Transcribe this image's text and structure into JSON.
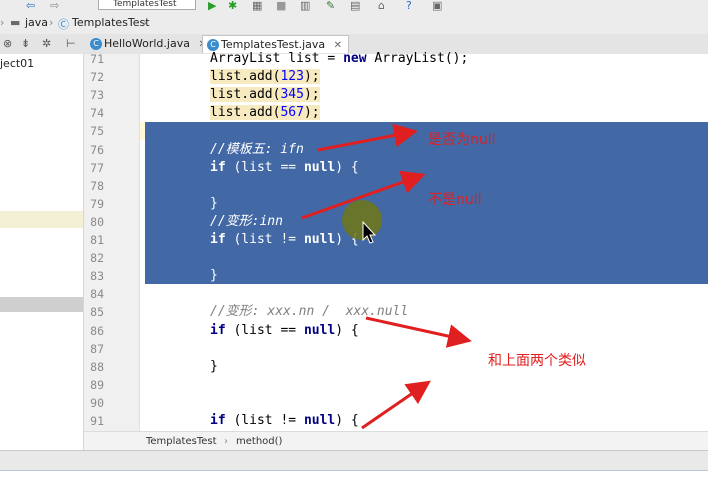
{
  "toolbar": {
    "run_config": "TemplatesTest",
    "icons": [
      "back-icon",
      "forward-icon",
      "run-icon",
      "debug-icon",
      "coverage-icon",
      "stop-icon",
      "project-structure-icon",
      "settings-icon",
      "sdk-icon",
      "help-icon",
      "tool-icon"
    ]
  },
  "breadcrumb": {
    "folder": "java",
    "class": "TemplatesTest"
  },
  "tabs": [
    {
      "label": "HelloWorld.java",
      "active": false
    },
    {
      "label": "TemplatesTest.java",
      "active": true
    }
  ],
  "project_panel": {
    "item": "ject01"
  },
  "editor": {
    "lines": [
      {
        "n": "71",
        "text": "ArrayList list = new ArrayList();"
      },
      {
        "n": "72",
        "text": "list.add(123);"
      },
      {
        "n": "73",
        "text": "list.add(345);"
      },
      {
        "n": "74",
        "text": "list.add(567);"
      },
      {
        "n": "75",
        "text": ""
      },
      {
        "n": "76",
        "text": "//模板五: ifn"
      },
      {
        "n": "77",
        "text": "if (list == null) {"
      },
      {
        "n": "78",
        "text": ""
      },
      {
        "n": "79",
        "text": "}"
      },
      {
        "n": "80",
        "text": "//变形:inn"
      },
      {
        "n": "81",
        "text": "if (list != null) {"
      },
      {
        "n": "82",
        "text": ""
      },
      {
        "n": "83",
        "text": "}"
      },
      {
        "n": "84",
        "text": ""
      },
      {
        "n": "85",
        "text": "//变形: xxx.nn /  xxx.null"
      },
      {
        "n": "86",
        "text": "if (list == null) {"
      },
      {
        "n": "87",
        "text": ""
      },
      {
        "n": "88",
        "text": "}"
      },
      {
        "n": "89",
        "text": ""
      },
      {
        "n": "90",
        "text": ""
      },
      {
        "n": "91",
        "text": "if (list != null) {"
      }
    ]
  },
  "status": {
    "class_crumb": "TemplatesTest",
    "method_crumb": "method()"
  },
  "annotations": {
    "a1": "是否为null",
    "a2": "不是null",
    "a3": "和上面两个类似"
  },
  "colors": {
    "selection": "#4268a6",
    "annotation": "#e02020",
    "keyword": "#000080",
    "number": "#0000ff"
  }
}
